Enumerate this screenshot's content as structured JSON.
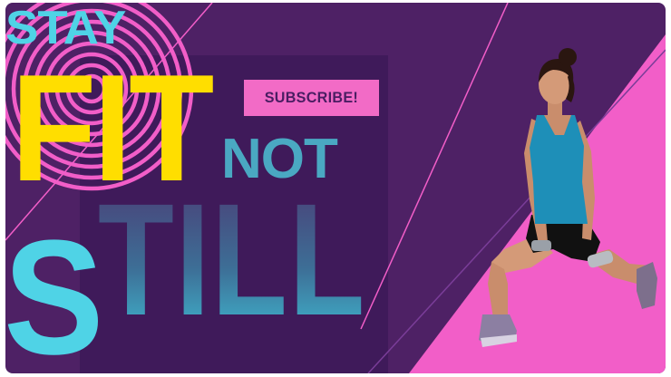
{
  "banner": {
    "headline_stay": "STAY",
    "headline_fit": "FIT",
    "headline_not": "NOT",
    "headline_still_s": "S",
    "headline_still_rest": "TILL",
    "subscribe_label": "SUBSCRIBE!"
  },
  "colors": {
    "background_purple": "#4e2165",
    "accent_pink": "#f25ec8",
    "headline_yellow": "#ffde00",
    "headline_cyan": "#4fd3e6",
    "subscribe_bg": "#f26bc6"
  },
  "icons": {
    "target_rings": "concentric-rings-graphic",
    "athlete": "woman-lunge-with-dumbbells-illustration"
  }
}
